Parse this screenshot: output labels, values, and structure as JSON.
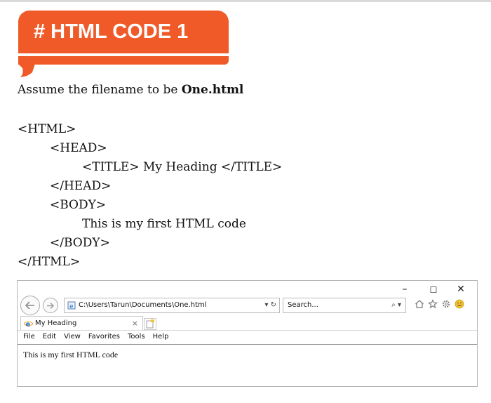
{
  "heading": {
    "title": "# HTML CODE 1"
  },
  "assume": {
    "prefix": "Assume the filename to be ",
    "filename": "One.html"
  },
  "code_lines": [
    "<HTML>",
    "<HEAD>",
    "<TITLE> My Heading </TITLE>",
    "</HEAD>",
    "<BODY>",
    "This is my first HTML code",
    "</BODY>",
    "</HTML>"
  ],
  "browser": {
    "window_controls": {
      "minimize": "–",
      "maximize": "☐",
      "close": "✕"
    },
    "address": "C:\\Users\\Tarun\\Documents\\One.html",
    "address_controls": "▾ ↻",
    "search_placeholder": "Search...",
    "search_controls": "⌕ ▾",
    "tab_title": "My Heading",
    "tab_close": "×",
    "menu": [
      "File",
      "Edit",
      "View",
      "Favorites",
      "Tools",
      "Help"
    ],
    "page_text": "This is my first HTML code"
  },
  "colors": {
    "banner": "#ef5a28",
    "ie_blue": "#1f6fc7"
  },
  "icons": [
    "back-arrow-icon",
    "forward-arrow-icon",
    "ie-icon",
    "refresh-icon",
    "search-icon",
    "home-icon",
    "star-icon",
    "gear-icon",
    "smiley-icon",
    "new-tab-icon"
  ]
}
